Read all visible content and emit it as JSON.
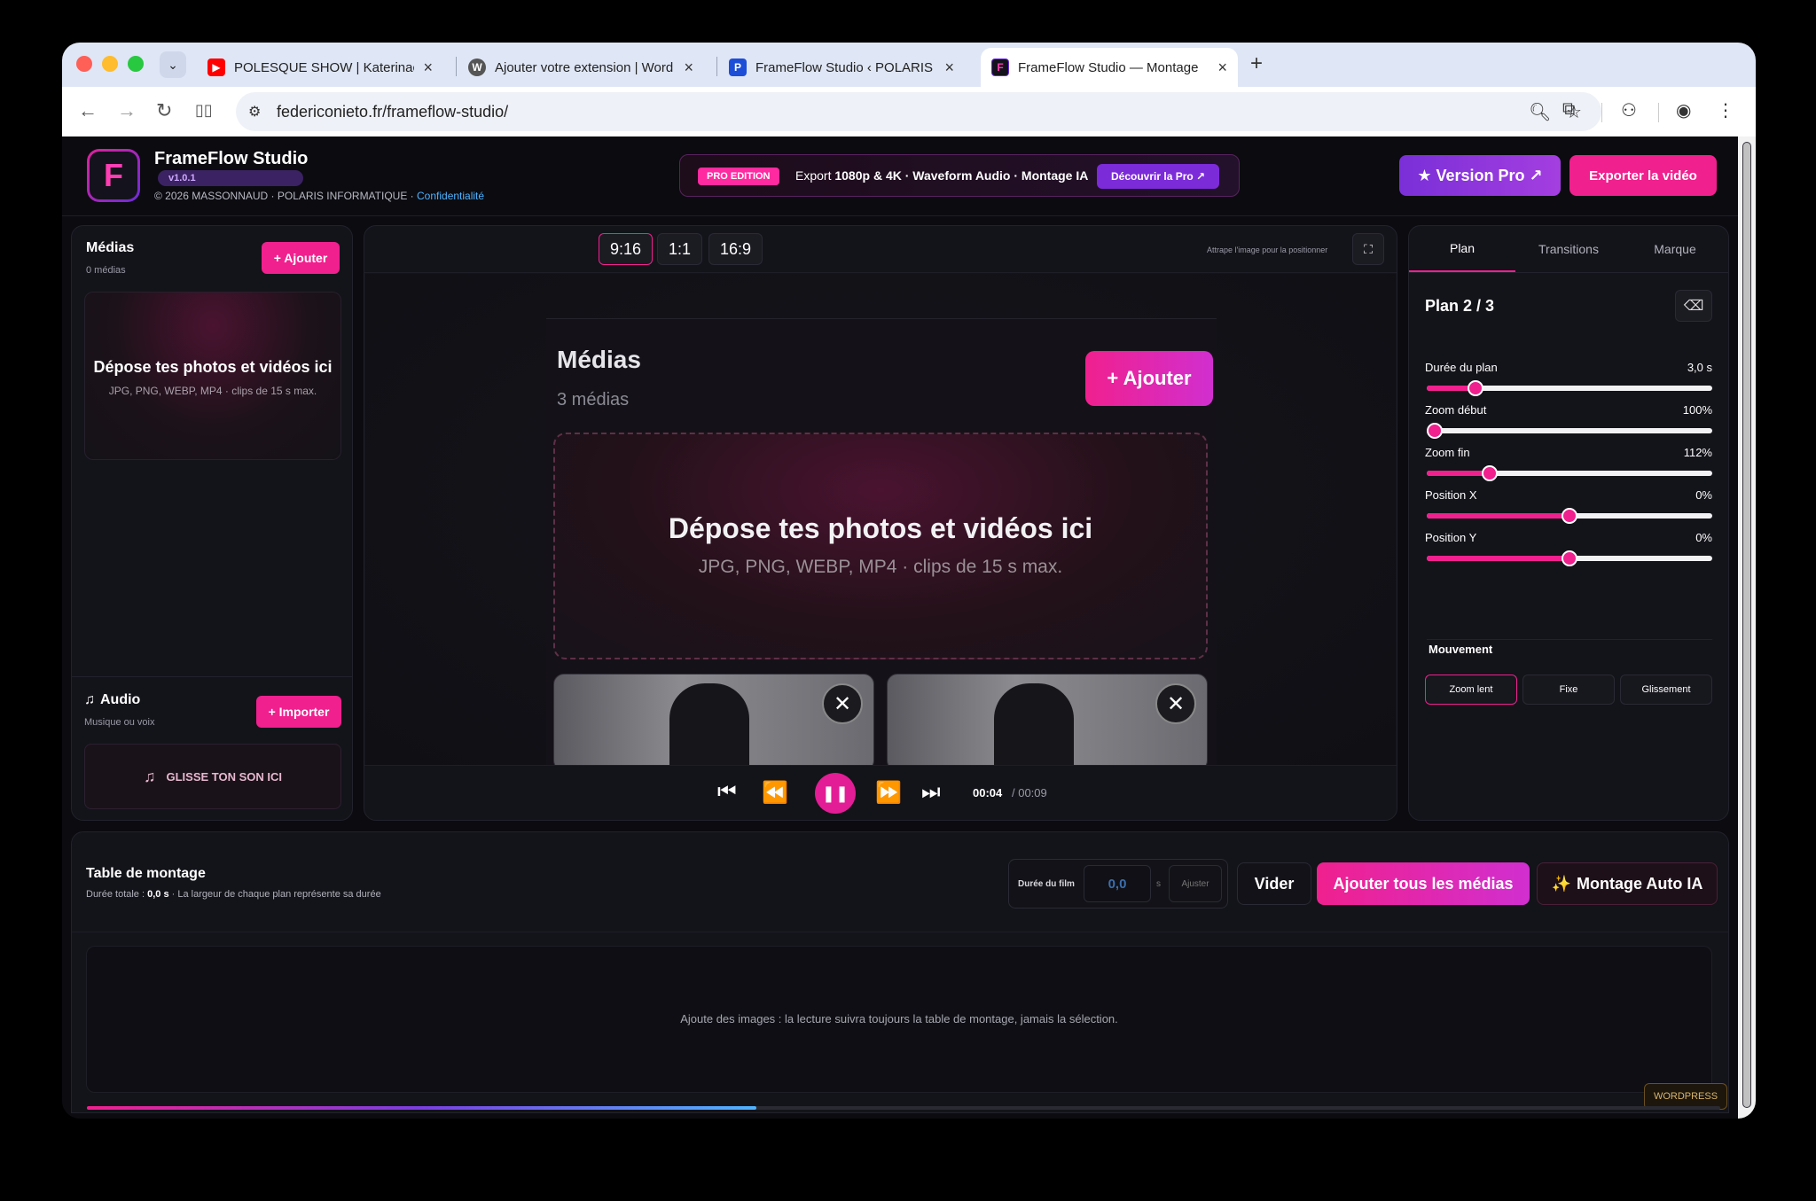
{
  "browser": {
    "tabs": [
      {
        "title": "POLESQUE SHOW | Katerinaс",
        "favicon_color": "#ff0000"
      },
      {
        "title": "Ajouter votre extension | Word",
        "favicon_color": "#555555"
      },
      {
        "title": "FrameFlow Studio ‹ POLARIS",
        "favicon_color": "#1d4ed8"
      },
      {
        "title": "FrameFlow Studio — Montage",
        "favicon_color": "#6b2bd9"
      }
    ],
    "url": "federiconieto.fr/frameflow-studio/"
  },
  "header": {
    "logo_letter": "F",
    "brand_name": "FrameFlow Studio",
    "version": "v1.0.1",
    "copyright": "© 2026 MASSONNAUD · POLARIS INFORMATIQUE ·",
    "privacy_link": "Confidentialité",
    "pro_tag": "PRO EDITION",
    "pro_text_prefix": "Export",
    "pro_text_bold": "1080p & 4K · Waveform Audio · Montage IA",
    "pro_cta": "Découvrir la Pro ↗",
    "version_pro_button": "★ Version Pro ↗",
    "export_button": "Exporter la vidéo"
  },
  "media_panel": {
    "title": "Médias",
    "count": "0 médias",
    "add_button": "+ Ajouter",
    "drop_title": "Dépose tes photos et vidéos ici",
    "drop_sub": "JPG, PNG, WEBP, MP4 · clips de 15 s max.",
    "audio_title": "Audio",
    "audio_sub": "Musique ou voix",
    "import_button": "+ Importer",
    "audio_drop": "GLISSE TON SON ICI"
  },
  "preview": {
    "ratios": [
      "9:16",
      "1:1",
      "16:9"
    ],
    "active_ratio": "9:16",
    "grab_hint": "Attrape l'image pour la positionner",
    "frame_title": "Médias",
    "frame_count": "3 médias",
    "frame_add": "+ Ajouter",
    "frame_drop_title": "Dépose tes photos et vidéos ici",
    "frame_drop_sub": "JPG, PNG, WEBP, MP4 · clips de 15 s max.",
    "time_current": "00:04",
    "time_total": "/ 00:09"
  },
  "settings": {
    "tabs": [
      "Plan",
      "Transitions",
      "Marque"
    ],
    "active_tab": "Plan",
    "plan_title": "Plan 2 / 3",
    "sliders": [
      {
        "label": "Durée du plan",
        "value": "3,0 s",
        "fraction": 0.17
      },
      {
        "label": "Zoom début",
        "value": "100%",
        "fraction": 0.0
      },
      {
        "label": "Zoom fin",
        "value": "112%",
        "fraction": 0.22
      },
      {
        "label": "Position X",
        "value": "0%",
        "fraction": 0.5
      },
      {
        "label": "Position Y",
        "value": "0%",
        "fraction": 0.5
      }
    ],
    "movement_title": "Mouvement",
    "movement_options": [
      "Zoom lent",
      "Fixe",
      "Glissement"
    ],
    "movement_active": "Zoom lent"
  },
  "timeline": {
    "title": "Table de montage",
    "sub_prefix": "Durée totale :",
    "sub_total": "0,0 s",
    "sub_suffix": "· La largeur de chaque plan représente sa durée",
    "duration_label": "Durée du film",
    "duration_value": "0,0",
    "duration_unit": "s",
    "adjust_button": "Ajuster",
    "clear_button": "Vider",
    "add_all_button": "Ajouter tous les médias",
    "auto_button": "Montage Auto IA",
    "empty_text": "Ajoute des images : la lecture suivra toujours la table de montage, jamais la sélection.",
    "progress_fraction": 0.41
  },
  "wordpress_badge": "WORDPRESS"
}
